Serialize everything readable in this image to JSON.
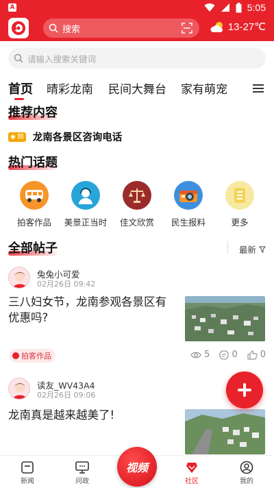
{
  "status_bar": {
    "time": "5:05"
  },
  "header": {
    "search_placeholder": "搜索",
    "weather": "13-27℃"
  },
  "search2": {
    "placeholder": "请输入搜索关键词"
  },
  "tabs": [
    {
      "label": "首页",
      "active": true
    },
    {
      "label": "晴彩龙南"
    },
    {
      "label": "民间大舞台"
    },
    {
      "label": "家有萌宠"
    }
  ],
  "recommend": {
    "title": "推荐内容",
    "badge": "精",
    "notice": "龙南各景区咨询电话"
  },
  "hot_topics": {
    "title": "热门话题",
    "items": [
      {
        "label": "拍客作品",
        "icon": "bus-icon",
        "color": "#f7942a"
      },
      {
        "label": "美景正当时",
        "icon": "service-person-icon",
        "color": "#27a4d8"
      },
      {
        "label": "佳文欣赏",
        "icon": "scales-icon",
        "color": "#9b2b2b"
      },
      {
        "label": "民生报料",
        "icon": "camera-icon",
        "color": "#3e8fe0"
      },
      {
        "label": "更多",
        "icon": "document-icon",
        "color": "#f5d35a"
      }
    ]
  },
  "all_posts": {
    "title": "全部帖子",
    "sort_label": "最新"
  },
  "posts": [
    {
      "username": "兔兔小可爱",
      "time": "02月26日  09:42",
      "title": "三八妇女节，龙南参观各景区有优惠吗?",
      "tag": "拍客作品",
      "views": "5",
      "comments": "0",
      "likes": "0"
    },
    {
      "username": "读友_WV43A4",
      "time": "02月26日  09:06",
      "title": "龙南真是越来越美了!"
    }
  ],
  "bottom_nav": [
    {
      "label": "新闻",
      "icon": "news-icon"
    },
    {
      "label": "问政",
      "icon": "chat-screen-icon"
    },
    {
      "label": "视频",
      "icon": "video-icon"
    },
    {
      "label": "社区",
      "icon": "community-icon",
      "active": true
    },
    {
      "label": "我的",
      "icon": "profile-icon"
    }
  ],
  "colors": {
    "brand": "#e8222b",
    "badge": "#f5a500"
  }
}
